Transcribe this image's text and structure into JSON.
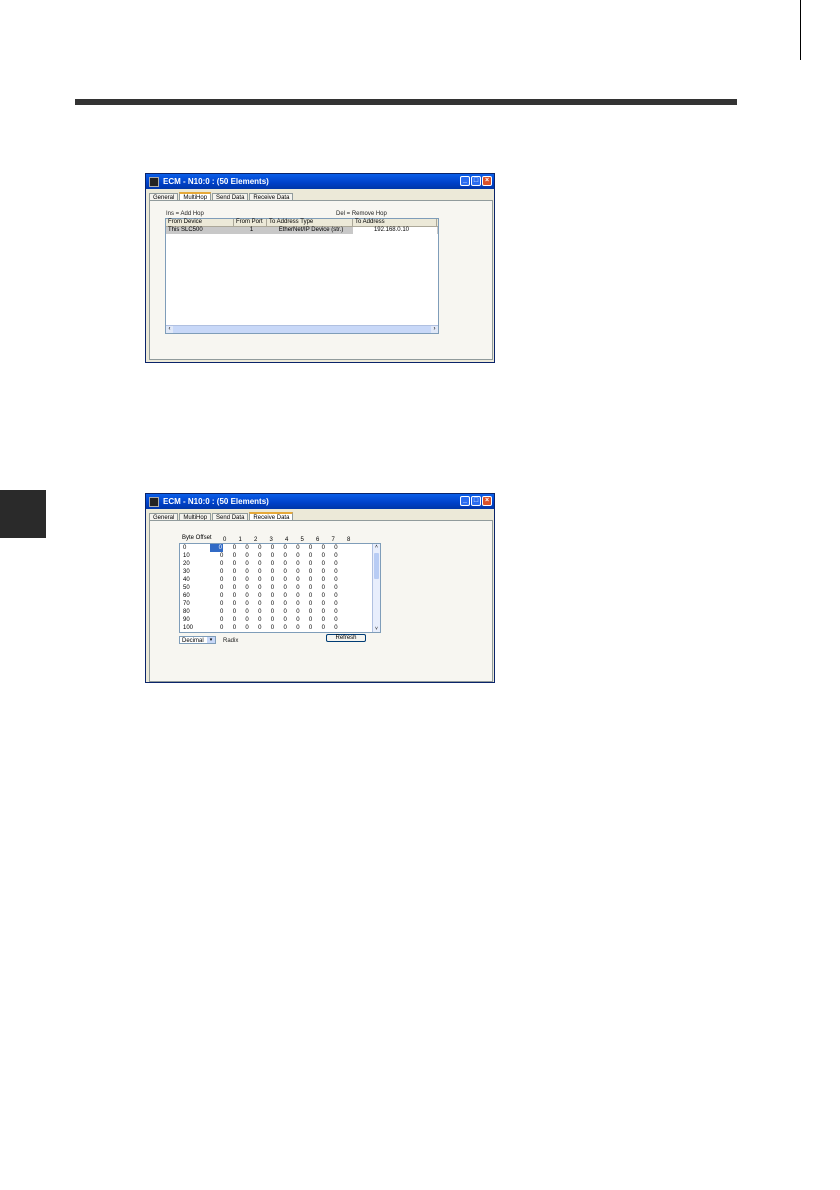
{
  "window1": {
    "title": "ECM - N10:0 : (50 Elements)",
    "tabs": [
      "General",
      "MultiHop",
      "Send Data",
      "Receive Data"
    ],
    "active_tab": "MultiHop",
    "ins_hint": "Ins = Add Hop",
    "del_hint": "Del = Remove Hop",
    "columns": [
      "From Device",
      "From Port",
      "To Address Type",
      "To Address"
    ],
    "rows": [
      [
        "This SLC500",
        "1",
        "EtherNet/IP Device (str.)",
        "192.168.0.10"
      ]
    ]
  },
  "window2": {
    "title": "ECM - N10:0 : (50 Elements)",
    "tabs": [
      "General",
      "MultiHop",
      "Send Data",
      "Receive Data"
    ],
    "active_tab": "Receive Data",
    "byte_offset_label": "Byte Offset",
    "column_headers": [
      "0",
      "1",
      "2",
      "3",
      "4",
      "5",
      "6",
      "7",
      "8"
    ],
    "rows": [
      {
        "offset": "0",
        "values": [
          "0",
          "0",
          "0",
          "0",
          "0",
          "0",
          "0",
          "0",
          "0",
          "0"
        ]
      },
      {
        "offset": "10",
        "values": [
          "0",
          "0",
          "0",
          "0",
          "0",
          "0",
          "0",
          "0",
          "0",
          "0"
        ]
      },
      {
        "offset": "20",
        "values": [
          "0",
          "0",
          "0",
          "0",
          "0",
          "0",
          "0",
          "0",
          "0",
          "0"
        ]
      },
      {
        "offset": "30",
        "values": [
          "0",
          "0",
          "0",
          "0",
          "0",
          "0",
          "0",
          "0",
          "0",
          "0"
        ]
      },
      {
        "offset": "40",
        "values": [
          "0",
          "0",
          "0",
          "0",
          "0",
          "0",
          "0",
          "0",
          "0",
          "0"
        ]
      },
      {
        "offset": "50",
        "values": [
          "0",
          "0",
          "0",
          "0",
          "0",
          "0",
          "0",
          "0",
          "0",
          "0"
        ]
      },
      {
        "offset": "60",
        "values": [
          "0",
          "0",
          "0",
          "0",
          "0",
          "0",
          "0",
          "0",
          "0",
          "0"
        ]
      },
      {
        "offset": "70",
        "values": [
          "0",
          "0",
          "0",
          "0",
          "0",
          "0",
          "0",
          "0",
          "0",
          "0"
        ]
      },
      {
        "offset": "80",
        "values": [
          "0",
          "0",
          "0",
          "0",
          "0",
          "0",
          "0",
          "0",
          "0",
          "0"
        ]
      },
      {
        "offset": "90",
        "values": [
          "0",
          "0",
          "0",
          "0",
          "0",
          "0",
          "0",
          "0",
          "0",
          "0"
        ]
      },
      {
        "offset": "100",
        "values": [
          "0",
          "0",
          "0",
          "0",
          "0",
          "0",
          "0",
          "0",
          "0",
          "0"
        ]
      }
    ],
    "radix_value": "Decimal",
    "radix_label": "Radix",
    "refresh_label": "Refresh"
  },
  "colors": {
    "titlebar": "#0040c8",
    "window_bg": "#ece9d8",
    "selection": "#316ac5"
  }
}
